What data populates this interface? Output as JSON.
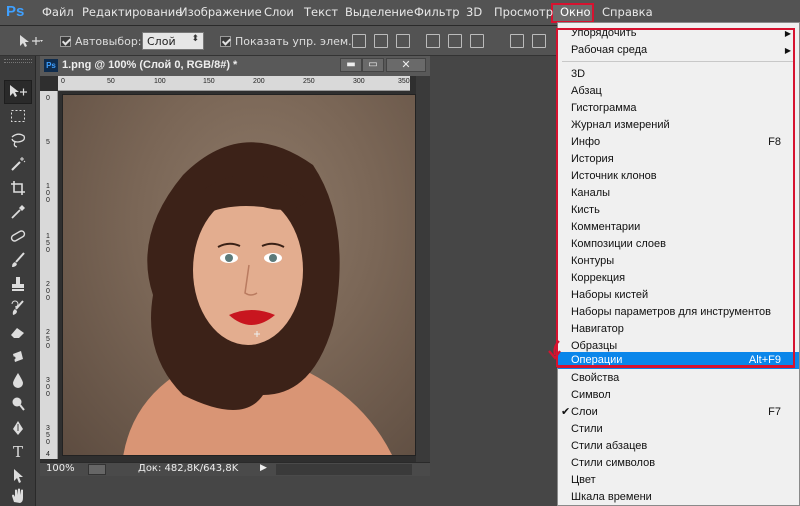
{
  "app": {
    "logo": "Ps"
  },
  "menubar": {
    "items": [
      "Файл",
      "Редактирование",
      "Изображение",
      "Слои",
      "Текст",
      "Выделение",
      "Фильтр",
      "3D",
      "Просмотр",
      "Окно",
      "Справка"
    ],
    "active": "Окно"
  },
  "options_bar": {
    "autoselect_label": "Автовыбор:",
    "autoselect_checked": true,
    "autoselect_value": "Слой",
    "show_transform_label": "Показать упр. элем.",
    "show_transform_checked": true
  },
  "tools": [
    "move-tool-icon",
    "marquee-tool-icon",
    "lasso-tool-icon",
    "magic-wand-icon",
    "crop-tool-icon",
    "eyedropper-icon",
    "healing-brush-icon",
    "brush-tool-icon",
    "clone-stamp-icon",
    "history-brush-icon",
    "eraser-icon",
    "gradient-tool-icon",
    "blur-tool-icon",
    "dodge-tool-icon",
    "pen-tool-icon",
    "type-tool-icon",
    "path-selection-icon",
    "hand-tool-icon"
  ],
  "document": {
    "title": "1.png @ 100% (Слой 0, RGB/8#) *",
    "zoom": "100%",
    "doc_size": "Док: 482,8K/643,8K",
    "ruler_top": [
      "0",
      "50",
      "100",
      "150",
      "200",
      "250",
      "300",
      "350"
    ],
    "ruler_left": [
      "0",
      "5",
      "1\n0\n0",
      "1\n5\n0",
      "2\n0\n0",
      "2\n5\n0",
      "3\n0\n0",
      "3\n5\n0",
      "4"
    ]
  },
  "window_menu": {
    "items": [
      {
        "label": "Упорядочить",
        "submenu": true
      },
      {
        "label": "Рабочая среда",
        "submenu": true
      },
      {
        "label": "3D"
      },
      {
        "label": "Абзац"
      },
      {
        "label": "Гистограмма"
      },
      {
        "label": "Журнал измерений"
      },
      {
        "label": "Инфо",
        "shortcut": "F8"
      },
      {
        "label": "История"
      },
      {
        "label": "Источник клонов"
      },
      {
        "label": "Каналы"
      },
      {
        "label": "Кисть"
      },
      {
        "label": "Комментарии"
      },
      {
        "label": "Композиции слоев"
      },
      {
        "label": "Контуры"
      },
      {
        "label": "Коррекция"
      },
      {
        "label": "Наборы кистей"
      },
      {
        "label": "Наборы параметров для инструментов"
      },
      {
        "label": "Навигатор"
      },
      {
        "label": "Образцы"
      },
      {
        "label": "Операции",
        "shortcut": "Alt+F9",
        "highlighted": true
      },
      {
        "label": "Свойства"
      },
      {
        "label": "Символ"
      },
      {
        "label": "Слои",
        "shortcut": "F7",
        "checked": true
      },
      {
        "label": "Стили"
      },
      {
        "label": "Стили абзацев"
      },
      {
        "label": "Стили символов"
      },
      {
        "label": "Цвет"
      },
      {
        "label": "Шкала времени"
      }
    ]
  },
  "colors": {
    "accent_red": "#d6122f",
    "highlight_blue": "#0a86ea",
    "ps_blue": "#3fa0ff"
  }
}
